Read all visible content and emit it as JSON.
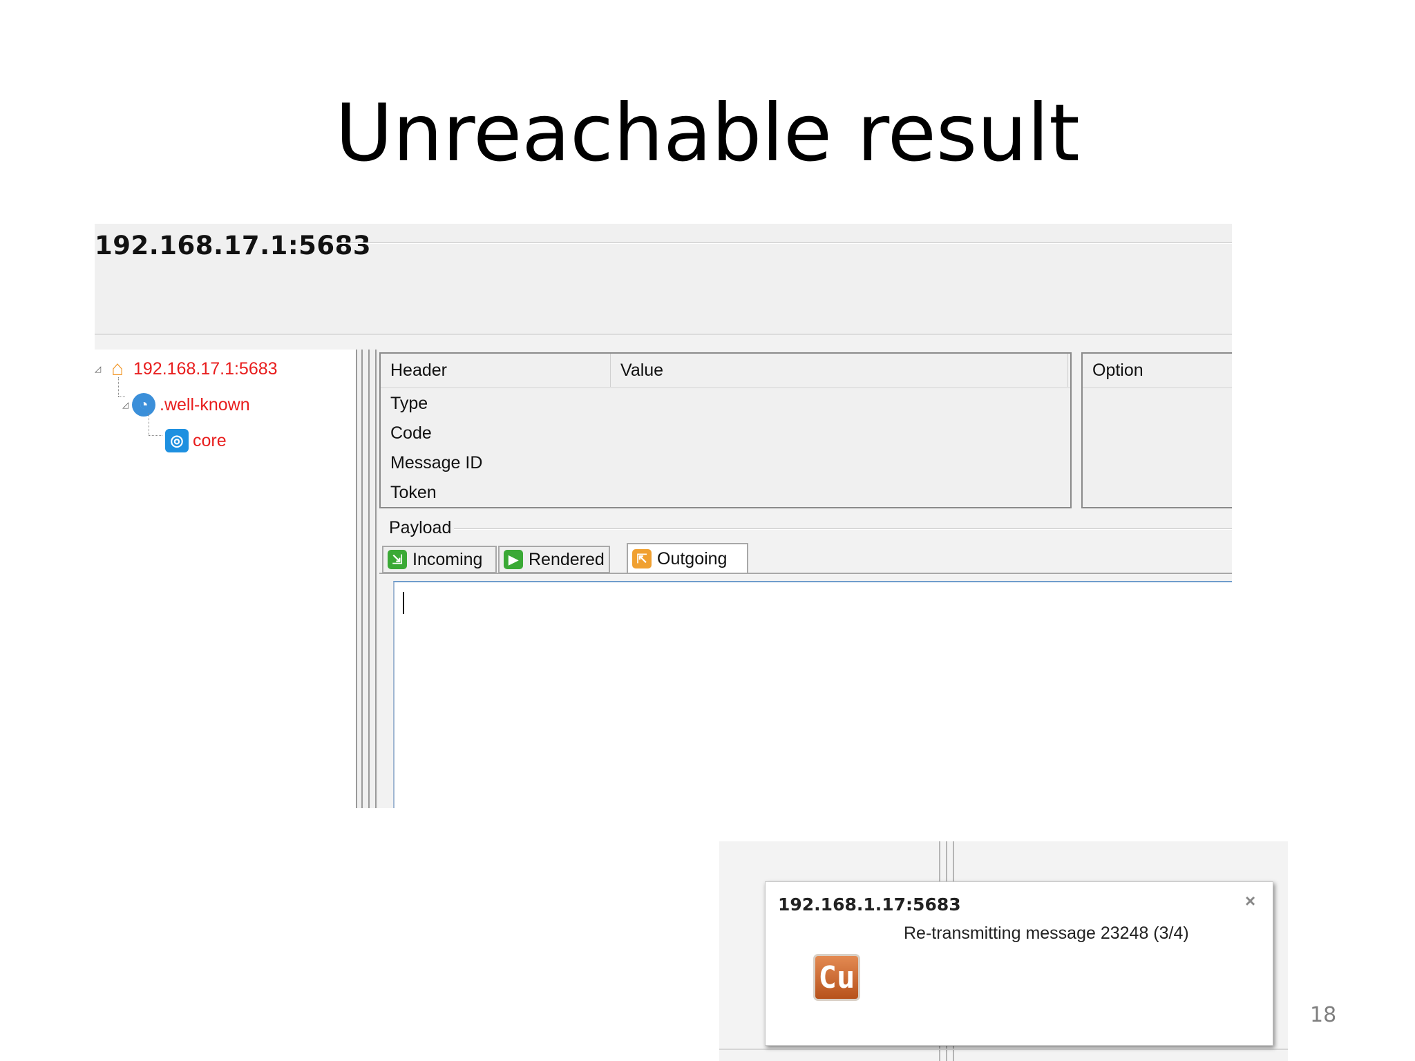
{
  "slide": {
    "title": "Unreachable result",
    "page_number": "18"
  },
  "copper": {
    "uri": "192.168.17.1:5683",
    "tree": [
      {
        "label": "192.168.17.1:5683",
        "icon": "home-icon"
      },
      {
        "label": ".well-known",
        "icon": "globe-icon"
      },
      {
        "label": "core",
        "icon": "search-icon"
      }
    ],
    "header_table": {
      "columns": [
        "Header",
        "Value"
      ],
      "rows": [
        "Type",
        "Code",
        "Message ID",
        "Token"
      ]
    },
    "option_table": {
      "columns": [
        "Option"
      ]
    },
    "payload": {
      "label": "Payload",
      "tabs": [
        {
          "label": "Incoming",
          "icon": "incoming-icon",
          "color": "#3aa935"
        },
        {
          "label": "Rendered",
          "icon": "rendered-icon",
          "color": "#3aa935"
        },
        {
          "label": "Outgoing",
          "icon": "outgoing-icon",
          "color": "#f0a030"
        }
      ],
      "active_tab": "Outgoing",
      "text": ""
    },
    "colors": {
      "tree_text": "#e81d1d",
      "home_icon": "#f29a2e",
      "globe_icon": "#3b8fd9",
      "search_icon": "#1e90e0"
    }
  },
  "notification": {
    "title": "192.168.1.17:5683",
    "message": "Re-transmitting message 23248 (3/4)",
    "logo_text": "Cu",
    "close_symbol": "×"
  }
}
